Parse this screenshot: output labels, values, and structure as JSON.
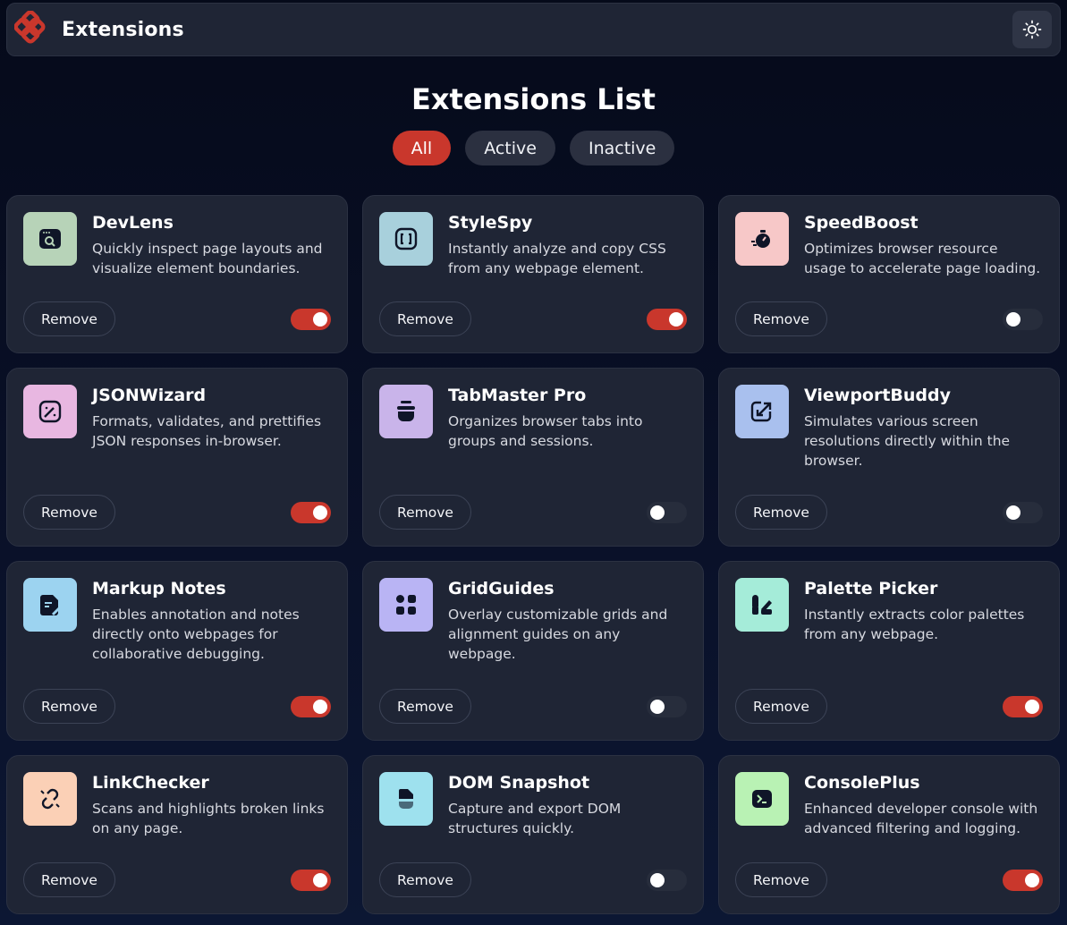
{
  "header": {
    "brand_title": "Extensions",
    "theme_icon": "sun-icon"
  },
  "page_title": "Extensions List",
  "filters": [
    {
      "label": "All",
      "active": true
    },
    {
      "label": "Active",
      "active": false
    },
    {
      "label": "Inactive",
      "active": false
    }
  ],
  "colors": {
    "accent": "#c9372c",
    "card_bg": "#1f2535",
    "page_bg": "#0a1129"
  },
  "extensions": [
    {
      "name": "DevLens",
      "description": "Quickly inspect page layouts and visualize element boundaries.",
      "enabled": true,
      "icon": "devlens-icon",
      "icon_bg": "#b7d3b8",
      "remove_label": "Remove"
    },
    {
      "name": "StyleSpy",
      "description": "Instantly analyze and copy CSS from any webpage element.",
      "enabled": true,
      "icon": "stylespy-icon",
      "icon_bg": "#a8d0dc",
      "remove_label": "Remove"
    },
    {
      "name": "SpeedBoost",
      "description": "Optimizes browser resource usage to accelerate page loading.",
      "enabled": false,
      "icon": "speedboost-icon",
      "icon_bg": "#f7c8c8",
      "remove_label": "Remove"
    },
    {
      "name": "JSONWizard",
      "description": "Formats, validates, and prettifies JSON responses in-browser.",
      "enabled": true,
      "icon": "jsonwizard-icon",
      "icon_bg": "#e8b7e1",
      "remove_label": "Remove"
    },
    {
      "name": "TabMaster Pro",
      "description": "Organizes browser tabs into groups and sessions.",
      "enabled": false,
      "icon": "tabmaster-icon",
      "icon_bg": "#c9b4ea",
      "remove_label": "Remove"
    },
    {
      "name": "ViewportBuddy",
      "description": "Simulates various screen resolutions directly within the browser.",
      "enabled": false,
      "icon": "viewportbuddy-icon",
      "icon_bg": "#a9c0ee",
      "remove_label": "Remove"
    },
    {
      "name": "Markup Notes",
      "description": "Enables annotation and notes directly onto webpages for collaborative debugging.",
      "enabled": true,
      "icon": "markupnotes-icon",
      "icon_bg": "#9cd3f0",
      "remove_label": "Remove"
    },
    {
      "name": "GridGuides",
      "description": "Overlay customizable grids and alignment guides on any webpage.",
      "enabled": false,
      "icon": "gridguides-icon",
      "icon_bg": "#b9b4f4",
      "remove_label": "Remove"
    },
    {
      "name": "Palette Picker",
      "description": "Instantly extracts color palettes from any webpage.",
      "enabled": true,
      "icon": "palettepicker-icon",
      "icon_bg": "#a5ecd9",
      "remove_label": "Remove"
    },
    {
      "name": "LinkChecker",
      "description": "Scans and highlights broken links on any page.",
      "enabled": true,
      "icon": "linkchecker-icon",
      "icon_bg": "#fbd0b6",
      "remove_label": "Remove"
    },
    {
      "name": "DOM Snapshot",
      "description": "Capture and export DOM structures quickly.",
      "enabled": false,
      "icon": "domsnapshot-icon",
      "icon_bg": "#9ee1ee",
      "remove_label": "Remove"
    },
    {
      "name": "ConsolePlus",
      "description": "Enhanced developer console with advanced filtering and logging.",
      "enabled": true,
      "icon": "consoleplus-icon",
      "icon_bg": "#b9f2b4",
      "remove_label": "Remove"
    }
  ]
}
